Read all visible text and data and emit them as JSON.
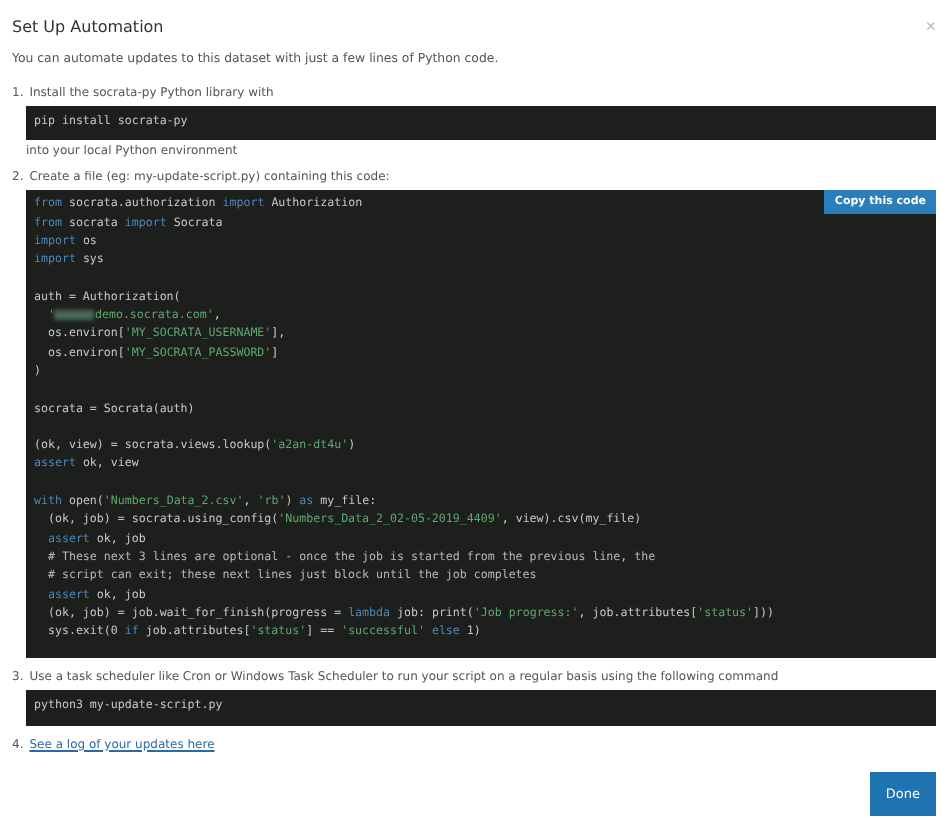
{
  "dialog": {
    "title": "Set Up Automation",
    "close": "×",
    "intro": "You can automate updates to this dataset with just a few lines of Python code."
  },
  "steps": [
    {
      "number": "1.",
      "text": "Install the socrata-py Python library with",
      "code": [
        {
          "kind": "code",
          "segments": [
            {
              "kind": "plain",
              "text": "pip install socrata-py"
            }
          ]
        }
      ],
      "after": "into your local Python environment"
    },
    {
      "number": "2.",
      "text": "Create a file (eg: my-update-script.py) containing this code:",
      "copy_button": "Copy this code",
      "code": [
        {
          "kind": "code",
          "segments": [
            {
              "kind": "keyword",
              "text": "from"
            },
            {
              "kind": "plain",
              "text": " socrata.authorization "
            },
            {
              "kind": "keyword",
              "text": "import"
            },
            {
              "kind": "plain",
              "text": " Authorization"
            }
          ]
        },
        {
          "kind": "code",
          "segments": [
            {
              "kind": "keyword",
              "text": "from"
            },
            {
              "kind": "plain",
              "text": " socrata "
            },
            {
              "kind": "keyword",
              "text": "import"
            },
            {
              "kind": "plain",
              "text": " Socrata"
            }
          ]
        },
        {
          "kind": "code",
          "segments": [
            {
              "kind": "keyword",
              "text": "import"
            },
            {
              "kind": "plain",
              "text": " os"
            }
          ]
        },
        {
          "kind": "code",
          "segments": [
            {
              "kind": "keyword",
              "text": "import"
            },
            {
              "kind": "plain",
              "text": " sys"
            }
          ]
        },
        {
          "kind": "blank"
        },
        {
          "kind": "code",
          "segments": [
            {
              "kind": "plain",
              "text": "auth = Authorization("
            }
          ]
        },
        {
          "kind": "code",
          "segments": [
            {
              "kind": "string",
              "text": "  '"
            },
            {
              "kind": "redacted"
            },
            {
              "kind": "string",
              "text": "demo.socrata.com'"
            },
            {
              "kind": "plain",
              "text": ","
            }
          ]
        },
        {
          "kind": "code",
          "segments": [
            {
              "kind": "plain",
              "text": "  os.environ["
            },
            {
              "kind": "string",
              "text": "'MY_SOCRATA_USERNAME'"
            },
            {
              "kind": "plain",
              "text": "],"
            }
          ]
        },
        {
          "kind": "code",
          "segments": [
            {
              "kind": "plain",
              "text": "  os.environ["
            },
            {
              "kind": "string",
              "text": "'MY_SOCRATA_PASSWORD'"
            },
            {
              "kind": "plain",
              "text": "]"
            }
          ]
        },
        {
          "kind": "code",
          "segments": [
            {
              "kind": "plain",
              "text": ")"
            }
          ]
        },
        {
          "kind": "blank"
        },
        {
          "kind": "code",
          "segments": [
            {
              "kind": "plain",
              "text": "socrata = Socrata(auth)"
            }
          ]
        },
        {
          "kind": "blank"
        },
        {
          "kind": "code",
          "segments": [
            {
              "kind": "plain",
              "text": "(ok, view) = socrata.views.lookup("
            },
            {
              "kind": "string",
              "text": "'a2an-dt4u'"
            },
            {
              "kind": "plain",
              "text": ")"
            }
          ]
        },
        {
          "kind": "code",
          "segments": [
            {
              "kind": "keyword",
              "text": "assert"
            },
            {
              "kind": "plain",
              "text": " ok, view"
            }
          ]
        },
        {
          "kind": "blank"
        },
        {
          "kind": "code",
          "segments": [
            {
              "kind": "keyword",
              "text": "with"
            },
            {
              "kind": "plain",
              "text": " open("
            },
            {
              "kind": "string",
              "text": "'Numbers_Data_2.csv'"
            },
            {
              "kind": "plain",
              "text": ", "
            },
            {
              "kind": "string",
              "text": "'rb'"
            },
            {
              "kind": "plain",
              "text": ") "
            },
            {
              "kind": "keyword",
              "text": "as"
            },
            {
              "kind": "plain",
              "text": " my_file:"
            }
          ]
        },
        {
          "kind": "code",
          "segments": [
            {
              "kind": "plain",
              "text": "  (ok, job) = socrata.using_config("
            },
            {
              "kind": "string",
              "text": "'Numbers_Data_2_02-05-2019_4409'"
            },
            {
              "kind": "plain",
              "text": ", view).csv(my_file)"
            }
          ]
        },
        {
          "kind": "code",
          "segments": [
            {
              "kind": "keyword",
              "text": "  assert"
            },
            {
              "kind": "plain",
              "text": " ok, job"
            }
          ]
        },
        {
          "kind": "code",
          "segments": [
            {
              "kind": "comment",
              "text": "  # These next 3 lines are optional - once the job is started from the previous line, the"
            }
          ]
        },
        {
          "kind": "code",
          "segments": [
            {
              "kind": "comment",
              "text": "  # script can exit; these next lines just block until the job completes"
            }
          ]
        },
        {
          "kind": "code",
          "segments": [
            {
              "kind": "keyword",
              "text": "  assert"
            },
            {
              "kind": "plain",
              "text": " ok, job"
            }
          ]
        },
        {
          "kind": "code",
          "segments": [
            {
              "kind": "plain",
              "text": "  (ok, job) = job.wait_for_finish(progress = "
            },
            {
              "kind": "keyword",
              "text": "lambda"
            },
            {
              "kind": "plain",
              "text": " job: print("
            },
            {
              "kind": "string",
              "text": "'Job progress:'"
            },
            {
              "kind": "plain",
              "text": ", job.attributes["
            },
            {
              "kind": "string",
              "text": "'status'"
            },
            {
              "kind": "plain",
              "text": "]))"
            }
          ]
        },
        {
          "kind": "code",
          "segments": [
            {
              "kind": "plain",
              "text": "  sys.exit(0 "
            },
            {
              "kind": "keyword",
              "text": "if"
            },
            {
              "kind": "plain",
              "text": " job.attributes["
            },
            {
              "kind": "string",
              "text": "'status'"
            },
            {
              "kind": "plain",
              "text": "] == "
            },
            {
              "kind": "string",
              "text": "'successful' "
            },
            {
              "kind": "keyword",
              "text": "else"
            },
            {
              "kind": "plain",
              "text": " 1)"
            }
          ]
        }
      ]
    },
    {
      "number": "3.",
      "text": "Use a task scheduler like Cron or Windows Task Scheduler to run your script on a regular basis using the following command",
      "code": [
        {
          "kind": "code",
          "segments": [
            {
              "kind": "plain",
              "text": "python3 my-update-script.py"
            }
          ]
        }
      ]
    },
    {
      "number": "4.",
      "link": "See a log of your updates here"
    }
  ],
  "done_button": "Done"
}
